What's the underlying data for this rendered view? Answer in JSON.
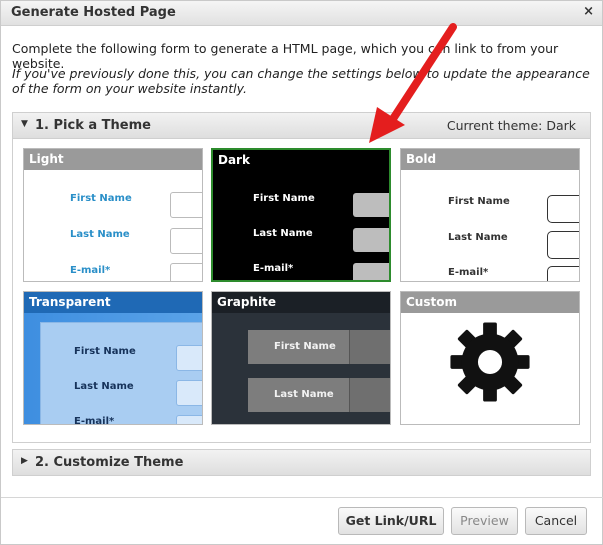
{
  "dialog": {
    "title": "Generate Hosted Page",
    "close_label": "×",
    "intro": "Complete the following form to generate a HTML page, which you can link to from your website.",
    "intro_italic": "If you've previously done this, you can change the settings below to update the appearance of the form on your website instantly."
  },
  "section1": {
    "label": "1. Pick a Theme",
    "current": "Current theme: Dark",
    "arrow_icon": "triangle-down-icon"
  },
  "section2": {
    "label": "2. Customize Theme",
    "arrow_icon": "triangle-right-icon"
  },
  "themes": {
    "light": {
      "name": "Light",
      "f1": "First Name",
      "f2": "Last Name",
      "f3": "E-mail*"
    },
    "dark": {
      "name": "Dark",
      "f1": "First Name",
      "f2": "Last Name",
      "f3": "E-mail*",
      "selected": true
    },
    "bold": {
      "name": "Bold",
      "f1": "First Name",
      "f2": "Last Name",
      "f3": "E-mail*"
    },
    "transparent": {
      "name": "Transparent",
      "f1": "First Name",
      "f2": "Last Name",
      "f3": "E-mail*"
    },
    "graphite": {
      "name": "Graphite",
      "f1": "First Name",
      "f2": "Last Name"
    },
    "custom": {
      "name": "Custom",
      "icon": "gear-icon"
    }
  },
  "buttons": {
    "get_link": "Get Link/URL",
    "preview": "Preview",
    "cancel": "Cancel"
  },
  "colors": {
    "selected_border": "#2d8b2d",
    "light_label": "#2a8fc8",
    "annotation_arrow": "#e41e1e"
  }
}
